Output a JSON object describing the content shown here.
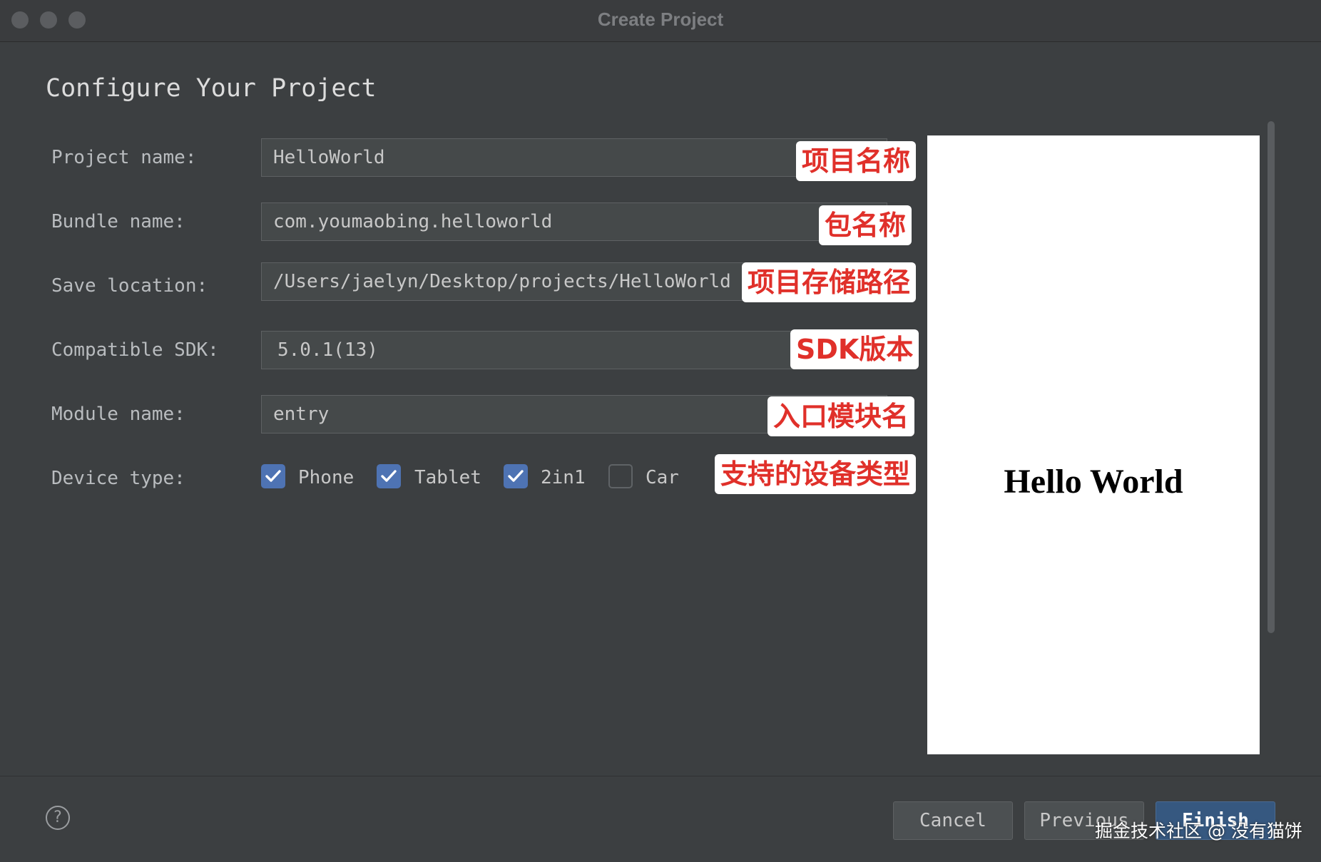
{
  "window": {
    "title": "Create Project"
  },
  "page": {
    "title": "Configure Your Project"
  },
  "form": {
    "project_name": {
      "label": "Project name:",
      "value": "HelloWorld"
    },
    "bundle_name": {
      "label": "Bundle name:",
      "value": "com.youmaobing.helloworld"
    },
    "save_location": {
      "label": "Save location:",
      "value": "/Users/jaelyn/Desktop/projects/HelloWorld"
    },
    "compatible_sdk": {
      "label": "Compatible SDK:",
      "value": "5.0.1(13)"
    },
    "module_name": {
      "label": "Module name:",
      "value": "entry"
    },
    "device_type": {
      "label": "Device type:",
      "options": [
        {
          "label": "Phone",
          "checked": true
        },
        {
          "label": "Tablet",
          "checked": true
        },
        {
          "label": "2in1",
          "checked": true
        },
        {
          "label": "Car",
          "checked": false
        }
      ]
    }
  },
  "annotations": {
    "project_name": "项目名称",
    "bundle_name": "包名称",
    "save_location": "项目存储路径",
    "compatible_sdk": "SDK版本",
    "module_name": "入口模块名",
    "device_type": "支持的设备类型"
  },
  "preview": {
    "text": "Hello World"
  },
  "footer": {
    "help_icon": "?",
    "cancel_label": "Cancel",
    "previous_label": "Previous",
    "finish_label": "Finish"
  },
  "watermark": "掘金技术社区 @ 没有猫饼",
  "colors": {
    "background": "#3c3f41",
    "checkbox_checked": "#4e73b3",
    "annotation_text": "#e0302a",
    "primary_button": "#365880"
  }
}
